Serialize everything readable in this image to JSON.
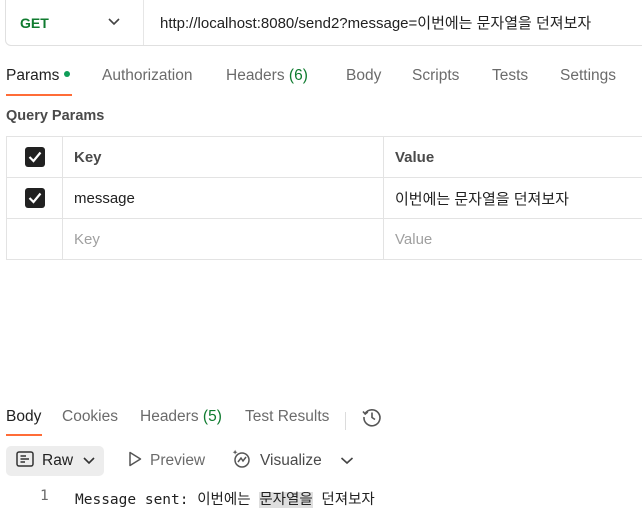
{
  "request": {
    "method": "GET",
    "url": "http://localhost:8080/send2?message=이번에는 문자열을 던져보자"
  },
  "request_tabs": [
    {
      "label": "Params",
      "active": true,
      "dot": true
    },
    {
      "label": "Authorization"
    },
    {
      "label": "Headers",
      "count": "(6)"
    },
    {
      "label": "Body"
    },
    {
      "label": "Scripts"
    },
    {
      "label": "Tests"
    },
    {
      "label": "Settings"
    }
  ],
  "query_params": {
    "title": "Query Params",
    "headers": {
      "key": "Key",
      "value": "Value"
    },
    "rows": [
      {
        "checked": true,
        "key": "message",
        "value": "이번에는 문자열을 던져보자"
      }
    ],
    "placeholder": {
      "key": "Key",
      "value": "Value"
    }
  },
  "response_tabs": [
    {
      "label": "Body",
      "active": true
    },
    {
      "label": "Cookies"
    },
    {
      "label": "Headers",
      "count": "(5)"
    },
    {
      "label": "Test Results"
    }
  ],
  "toolbar": {
    "format": "Raw",
    "preview": "Preview",
    "visualize": "Visualize"
  },
  "response_body": {
    "line_number": "1",
    "prefix": "Message sent: 이번에는 ",
    "highlight": "문자열을",
    "suffix": " 던져보자"
  },
  "colors": {
    "accent": "#ff6c37",
    "method_get": "#0f7b2f",
    "dot": "#0f9d58"
  }
}
